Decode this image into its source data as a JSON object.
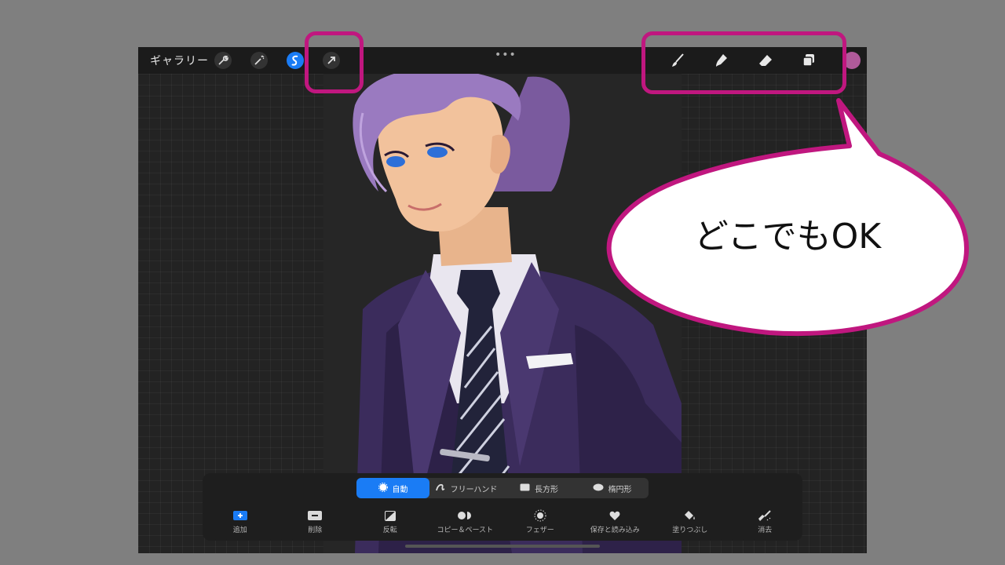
{
  "topbar": {
    "gallery_label": "ギャラリー",
    "left_icons": [
      "wrench-icon",
      "magic-wand-icon",
      "selection-icon",
      "transform-arrow-icon"
    ],
    "right_tools": [
      "brush-icon",
      "smudge-icon",
      "eraser-icon",
      "layers-icon"
    ],
    "more_label": "•••",
    "current_color": "#b05a9a"
  },
  "callout": {
    "text": "どこでもOK",
    "accent": "#c0177f"
  },
  "selection_modes": [
    {
      "label": "自動",
      "icon": "auto-selection-icon",
      "active": true
    },
    {
      "label": "フリーハンド",
      "icon": "freehand-icon",
      "active": false
    },
    {
      "label": "長方形",
      "icon": "rectangle-icon",
      "active": false
    },
    {
      "label": "楕円形",
      "icon": "ellipse-icon",
      "active": false
    }
  ],
  "selection_actions": [
    {
      "label": "追加",
      "icon": "add-icon"
    },
    {
      "label": "削除",
      "icon": "remove-icon"
    },
    {
      "label": "反転",
      "icon": "invert-icon"
    },
    {
      "label": "コピー＆ペースト",
      "icon": "copy-paste-icon"
    },
    {
      "label": "フェザー",
      "icon": "feather-icon"
    },
    {
      "label": "保存と読み込み",
      "icon": "save-load-icon"
    },
    {
      "label": "塗りつぶし",
      "icon": "fill-bucket-icon"
    },
    {
      "label": "消去",
      "icon": "clear-icon"
    }
  ],
  "colors": {
    "accent_blue": "#1a7cf5",
    "highlight_magenta": "#c0177f"
  }
}
